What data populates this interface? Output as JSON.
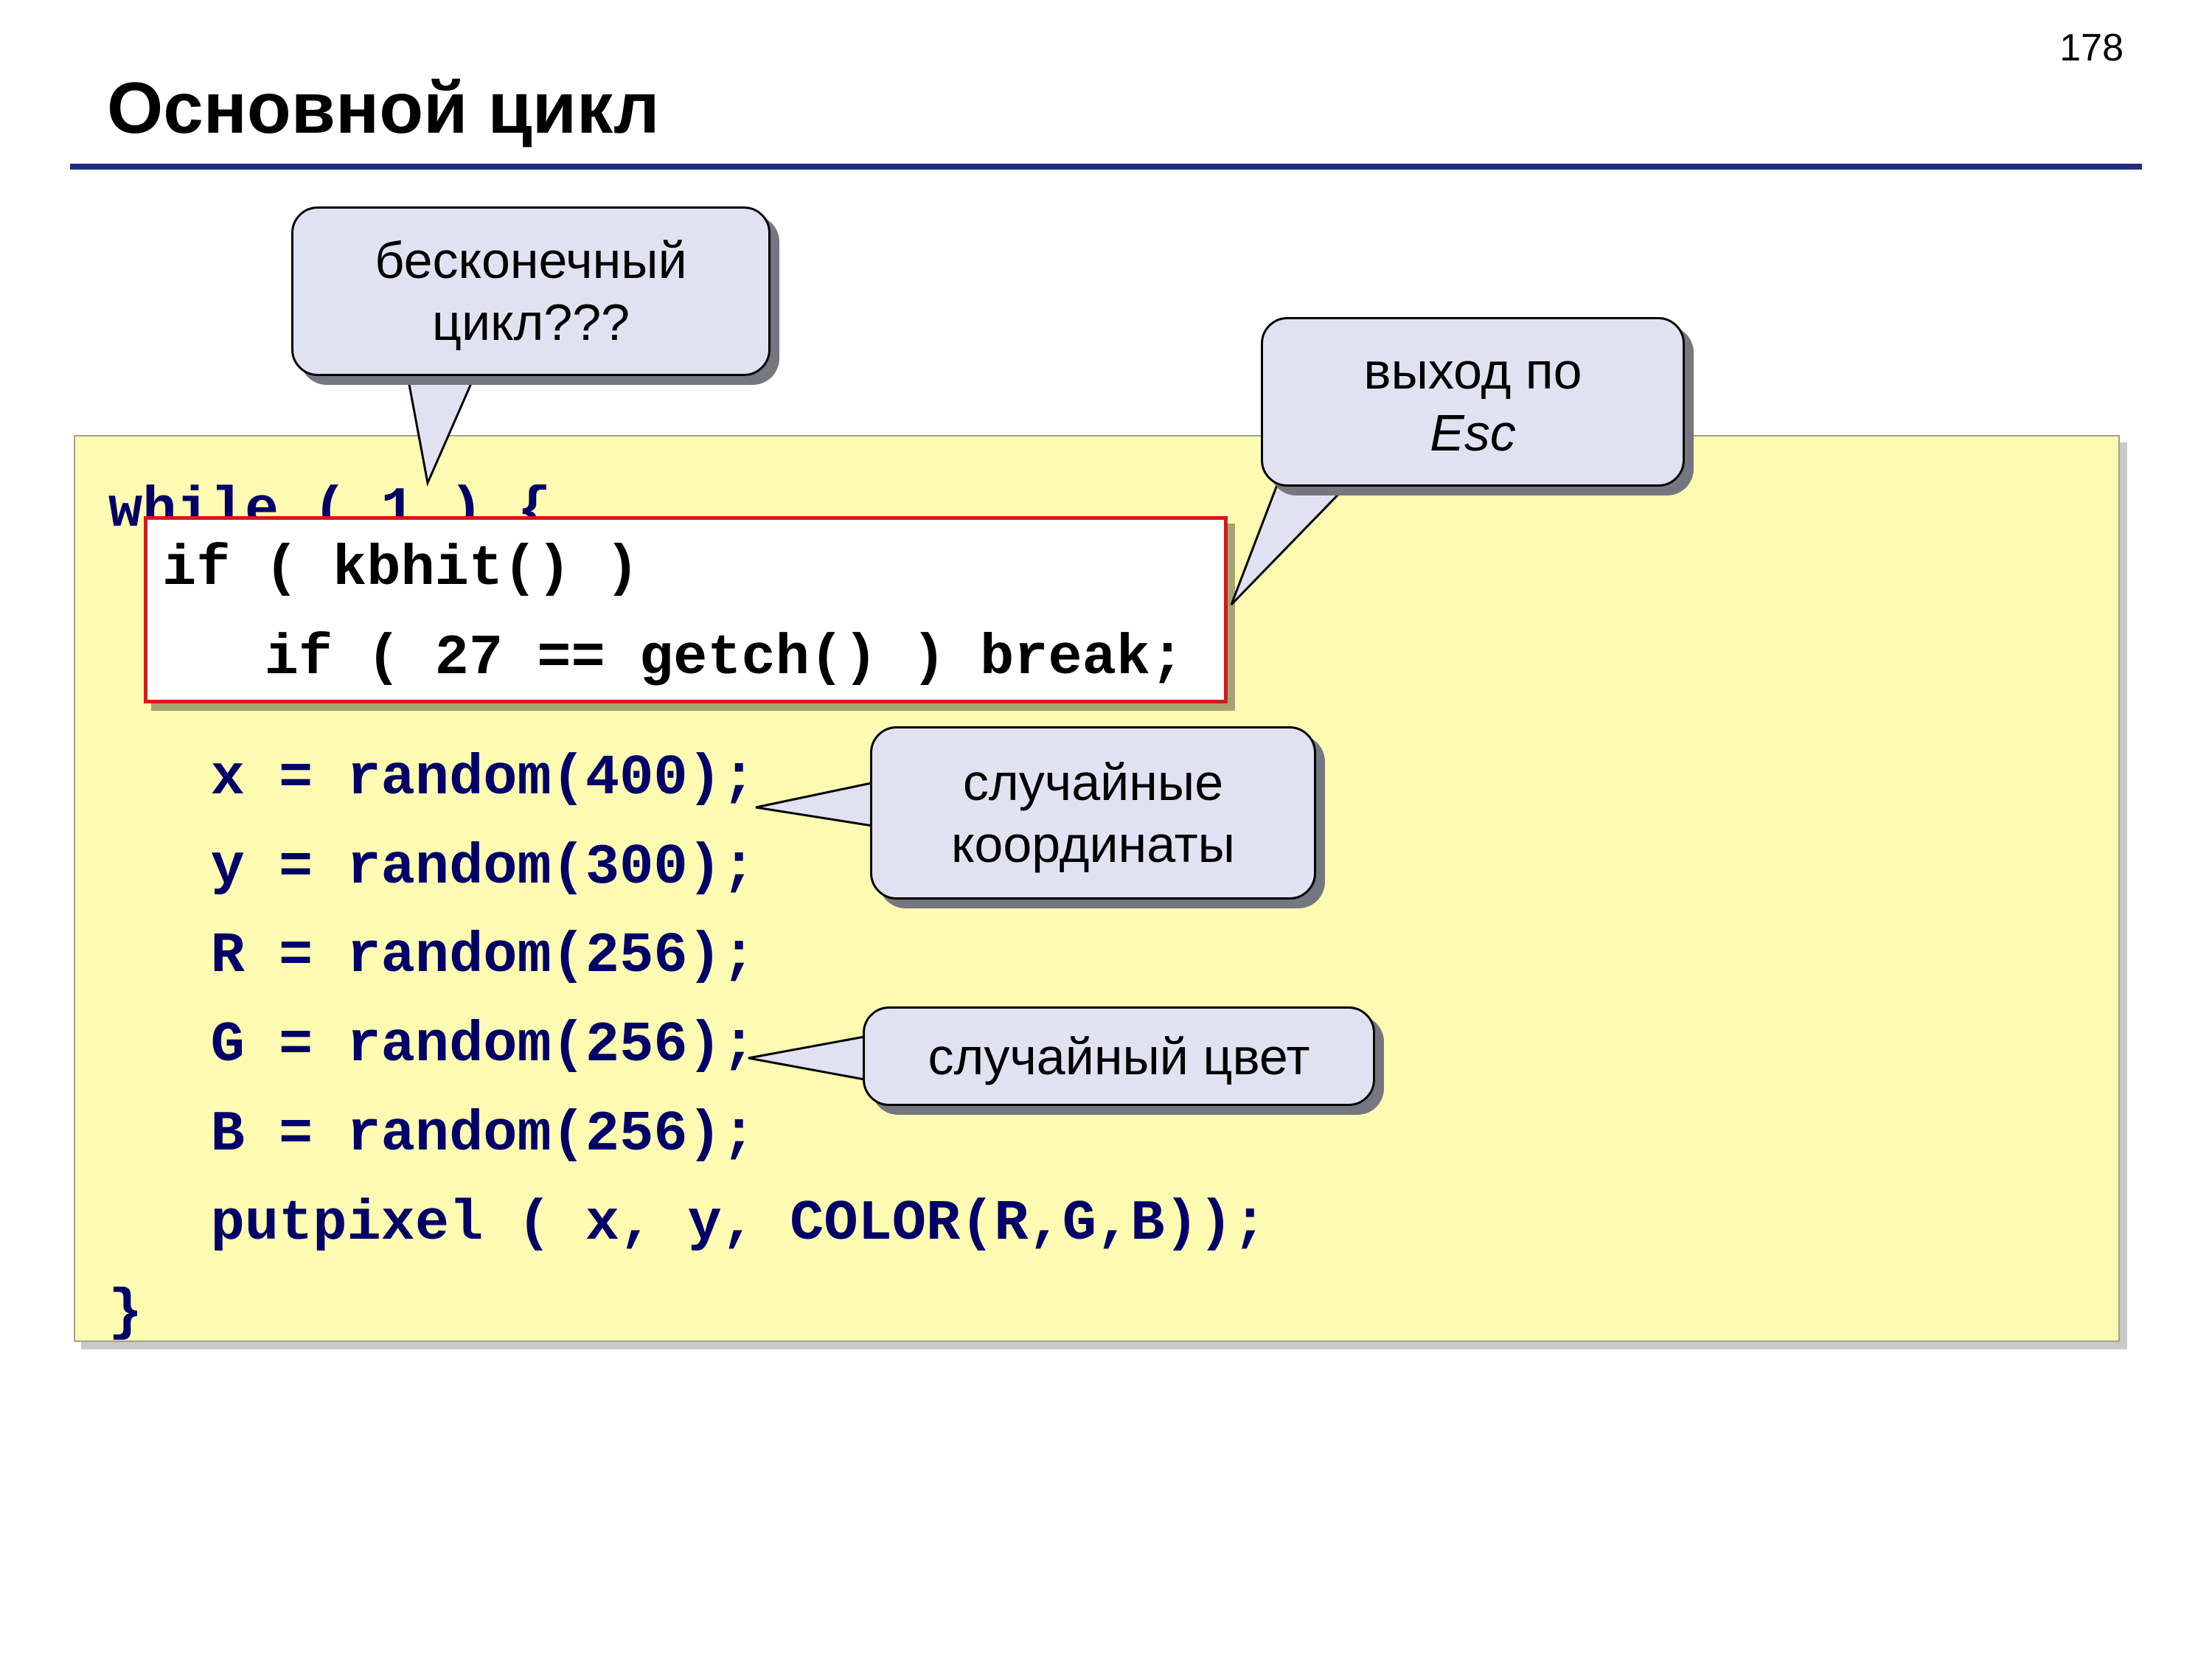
{
  "page_number": "178",
  "title": "Основной цикл",
  "code": {
    "l1": "while ( 1 ) {",
    "l6": "   x = random(400);",
    "l7": "   y = random(300);",
    "l8": "   R = random(256);",
    "l9": "   G = random(256);",
    "l10": "   B = random(256);",
    "l11": "   putpixel ( x, y, COLOR(R,G,B));",
    "l12": "}"
  },
  "redbox": {
    "r1": "if ( kbhit() )",
    "r2": "   if ( 27 == getch() ) break;"
  },
  "callouts": {
    "b1_l1": "бесконечный",
    "b1_l2": "цикл???",
    "b2_l1": "выход по",
    "b2_l2": "Esc",
    "b3_l1": "случайные",
    "b3_l2": "координаты",
    "b4": "случайный цвет"
  }
}
